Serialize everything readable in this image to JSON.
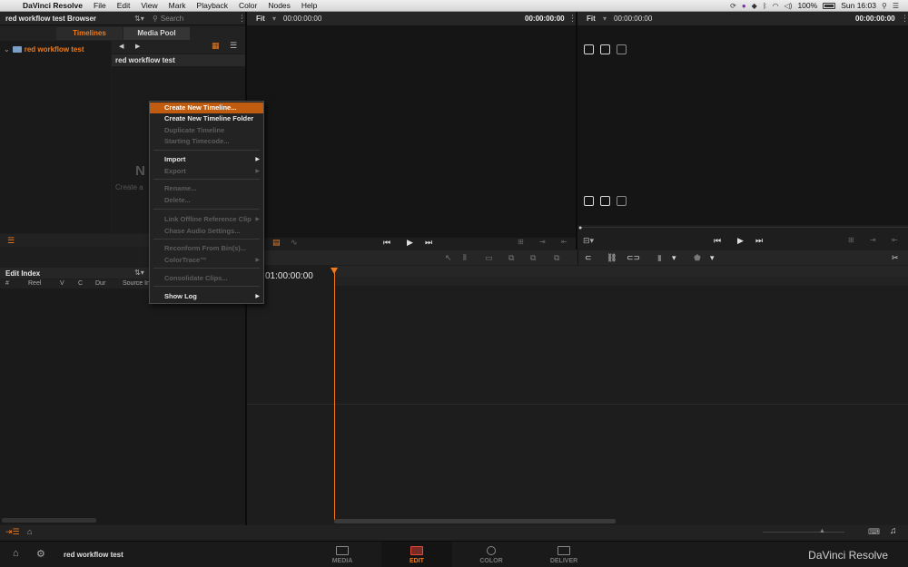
{
  "menubar": {
    "app_name": "DaVinci Resolve",
    "items": [
      "File",
      "Edit",
      "View",
      "Mark",
      "Playback",
      "Color",
      "Nodes",
      "Help"
    ],
    "battery": "100%",
    "clock": "Sun 16:03"
  },
  "browser": {
    "title": "red workflow test Browser",
    "search_placeholder": "Search",
    "tabs": [
      {
        "label": "Timelines",
        "active": true
      },
      {
        "label": "Media Pool",
        "active": false
      }
    ],
    "bin_item": "red workflow test",
    "clip_title": "red workflow test",
    "empty_title": "N",
    "empty_subtitle": "Create a"
  },
  "edit_index": {
    "title": "Edit Index",
    "columns": [
      "#",
      "Reel",
      "V",
      "C",
      "Dur",
      "Source In"
    ]
  },
  "source_viewer": {
    "zoom": "Fit",
    "timecode_left": "00:00:00:00",
    "timecode_right": "00:00:00:00"
  },
  "record_viewer": {
    "zoom": "Fit",
    "timecode_left": "00:00:00:00",
    "timecode_right": "00:00:00:00"
  },
  "timeline": {
    "timecode": "01:00:00:00"
  },
  "context_menu": {
    "items": [
      {
        "label": "Create New Timeline...",
        "enabled": true,
        "highlighted": true,
        "submenu": false
      },
      {
        "label": "Create New Timeline Folder",
        "enabled": true,
        "highlighted": false,
        "submenu": false
      },
      {
        "label": "Duplicate Timeline",
        "enabled": false,
        "highlighted": false,
        "submenu": false
      },
      {
        "label": "Starting Timecode...",
        "enabled": false,
        "highlighted": false,
        "submenu": false
      },
      {
        "label": "Import",
        "enabled": true,
        "highlighted": false,
        "submenu": true
      },
      {
        "label": "Export",
        "enabled": false,
        "highlighted": false,
        "submenu": true
      },
      {
        "label": "Rename...",
        "enabled": false,
        "highlighted": false,
        "submenu": false
      },
      {
        "label": "Delete...",
        "enabled": false,
        "highlighted": false,
        "submenu": false
      },
      {
        "label": "Link Offline Reference Clip",
        "enabled": false,
        "highlighted": false,
        "submenu": true
      },
      {
        "label": "Chase Audio Settings...",
        "enabled": false,
        "highlighted": false,
        "submenu": false
      },
      {
        "label": "Reconform From Bin(s)...",
        "enabled": false,
        "highlighted": false,
        "submenu": false
      },
      {
        "label": "ColorTrace™",
        "enabled": false,
        "highlighted": false,
        "submenu": true
      },
      {
        "label": "Consolidate Clips...",
        "enabled": false,
        "highlighted": false,
        "submenu": false
      },
      {
        "label": "Show Log",
        "enabled": true,
        "highlighted": false,
        "submenu": true
      }
    ]
  },
  "footer": {
    "project_name": "red workflow test",
    "pages": [
      {
        "label": "MEDIA",
        "active": false
      },
      {
        "label": "EDIT",
        "active": true
      },
      {
        "label": "COLOR",
        "active": false
      },
      {
        "label": "DELIVER",
        "active": false
      }
    ],
    "brand": "DaVinci Resolve"
  },
  "colors": {
    "accent": "#f07a1c",
    "menu_highlight": "#c05c10",
    "background": "#1e1e1e"
  }
}
